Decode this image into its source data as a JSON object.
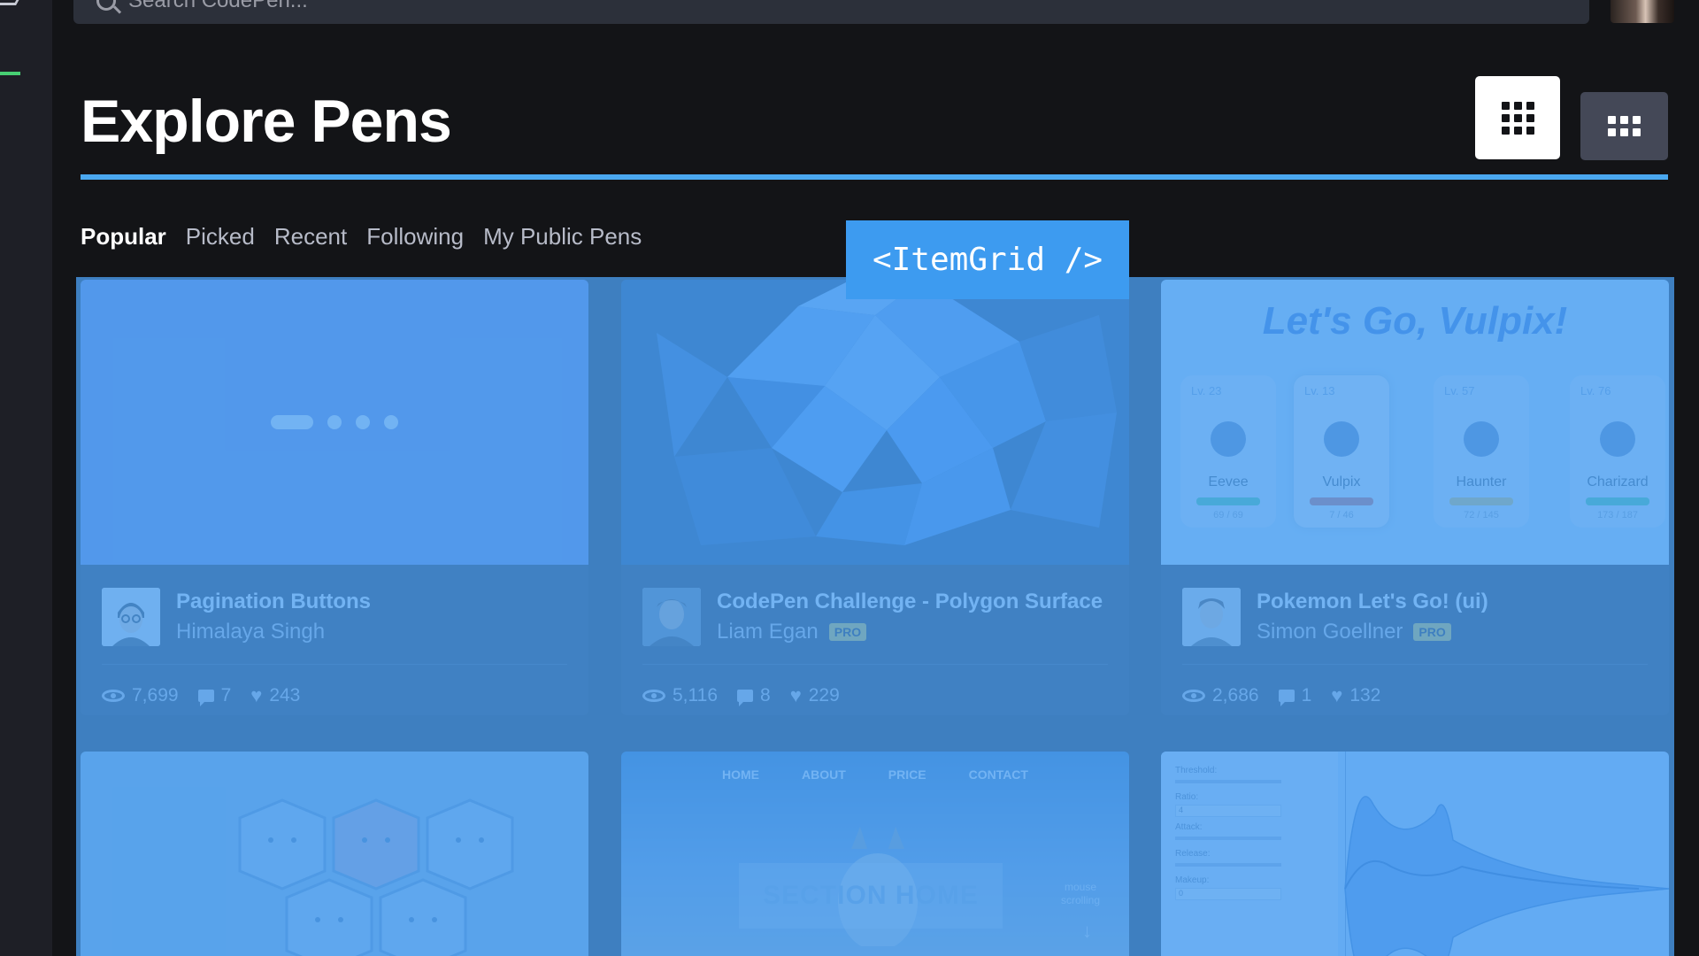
{
  "search": {
    "placeholder": "Search CodePen..."
  },
  "page": {
    "title": "Explore Pens"
  },
  "tabs": [
    {
      "label": "Popular",
      "active": true
    },
    {
      "label": "Picked",
      "active": false
    },
    {
      "label": "Recent",
      "active": false
    },
    {
      "label": "Following",
      "active": false
    },
    {
      "label": "My Public Pens",
      "active": false
    }
  ],
  "overlay_label": "<ItemGrid />",
  "colors": {
    "accent_blue": "#4aa8f0",
    "overlay_blue": "#4a9ef0",
    "brand_green": "#47cf73"
  },
  "cards": [
    {
      "title": "Pagination Buttons",
      "author": "Himalaya Singh",
      "pro": false,
      "views": "7,699",
      "comments": "7",
      "likes": "243"
    },
    {
      "title": "CodePen Challenge - Polygon Surface",
      "author": "Liam Egan",
      "pro": true,
      "pro_label": "PRO",
      "views": "5,116",
      "comments": "8",
      "likes": "229"
    },
    {
      "title": "Pokemon Let's Go! (ui)",
      "author": "Simon Goellner",
      "pro": true,
      "pro_label": "PRO",
      "views": "2,686",
      "comments": "1",
      "likes": "132"
    }
  ],
  "vulpix_preview": {
    "title": "Let's Go, Vulpix!",
    "pokemon": [
      {
        "level": "Lv. 23",
        "name": "Eevee",
        "hp": "69 / 69"
      },
      {
        "level": "Lv. 13",
        "name": "Vulpix",
        "hp": "7 / 46"
      },
      {
        "level": "Lv. 57",
        "name": "Haunter",
        "hp": "72 / 145"
      },
      {
        "level": "Lv. 76",
        "name": "Charizard",
        "hp": "173 / 187"
      }
    ]
  },
  "section_preview": {
    "nav": [
      "HOME",
      "ABOUT",
      "PRICE",
      "CONTACT"
    ],
    "box_text": "SECTION HOME",
    "mouse_text": "mouse scrolling"
  },
  "audio_preview": {
    "labels": [
      "Threshold:",
      "Ratio:",
      "Attack:",
      "Release:",
      "Makeup:"
    ],
    "ratio_value": "4",
    "makeup_value": "0"
  }
}
